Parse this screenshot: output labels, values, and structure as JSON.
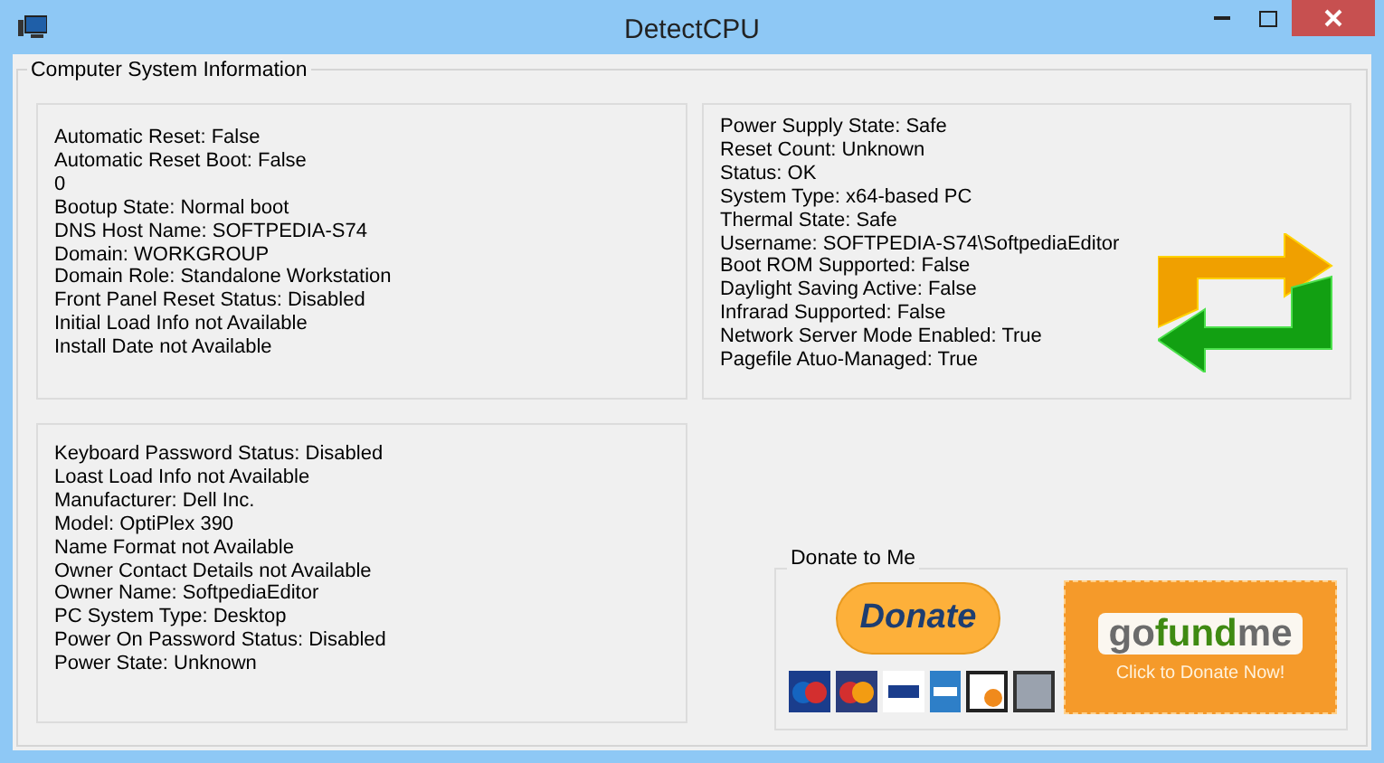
{
  "window": {
    "title": "DetectCPU"
  },
  "group": {
    "title": "Computer System Information"
  },
  "panels": [
    {
      "lines": [
        "Automatic Reset: False",
        "Automatic Reset Boot: False",
        "0",
        "Bootup State: Normal boot",
        "DNS Host Name: SOFTPEDIA-S74",
        "Domain: WORKGROUP",
        "Domain Role: Standalone Workstation",
        "Front Panel Reset Status: Disabled",
        "Initial Load Info not Available",
        "Install Date not Available"
      ]
    },
    {
      "lines": [
        "Power Supply State: Safe",
        "Reset Count: Unknown",
        "Status: OK",
        "System Type: x64-based PC",
        "Thermal State: Safe",
        "Username: SOFTPEDIA-S74\\SoftpediaEditor",
        "Boot ROM Supported: False",
        "Daylight Saving Active: False",
        "Infrarad Supported: False",
        "Network Server Mode Enabled: True",
        "Pagefile Atuo-Managed: True"
      ]
    },
    {
      "lines": [
        "Keyboard Password Status: Disabled",
        "Loast Load Info not Available",
        "Manufacturer: Dell Inc.",
        "Model: OptiPlex 390",
        "Name Format not Available",
        "Owner Contact Details not Available",
        "Owner Name: SoftpediaEditor",
        "PC System Type: Desktop",
        "Power On Password Status: Disabled",
        "Power State: Unknown"
      ]
    }
  ],
  "donate": {
    "title": "Donate to Me",
    "button": "Donate",
    "banner_logo_parts": [
      "go",
      "fund",
      "me"
    ],
    "banner_caption": "Click to Donate Now!"
  }
}
